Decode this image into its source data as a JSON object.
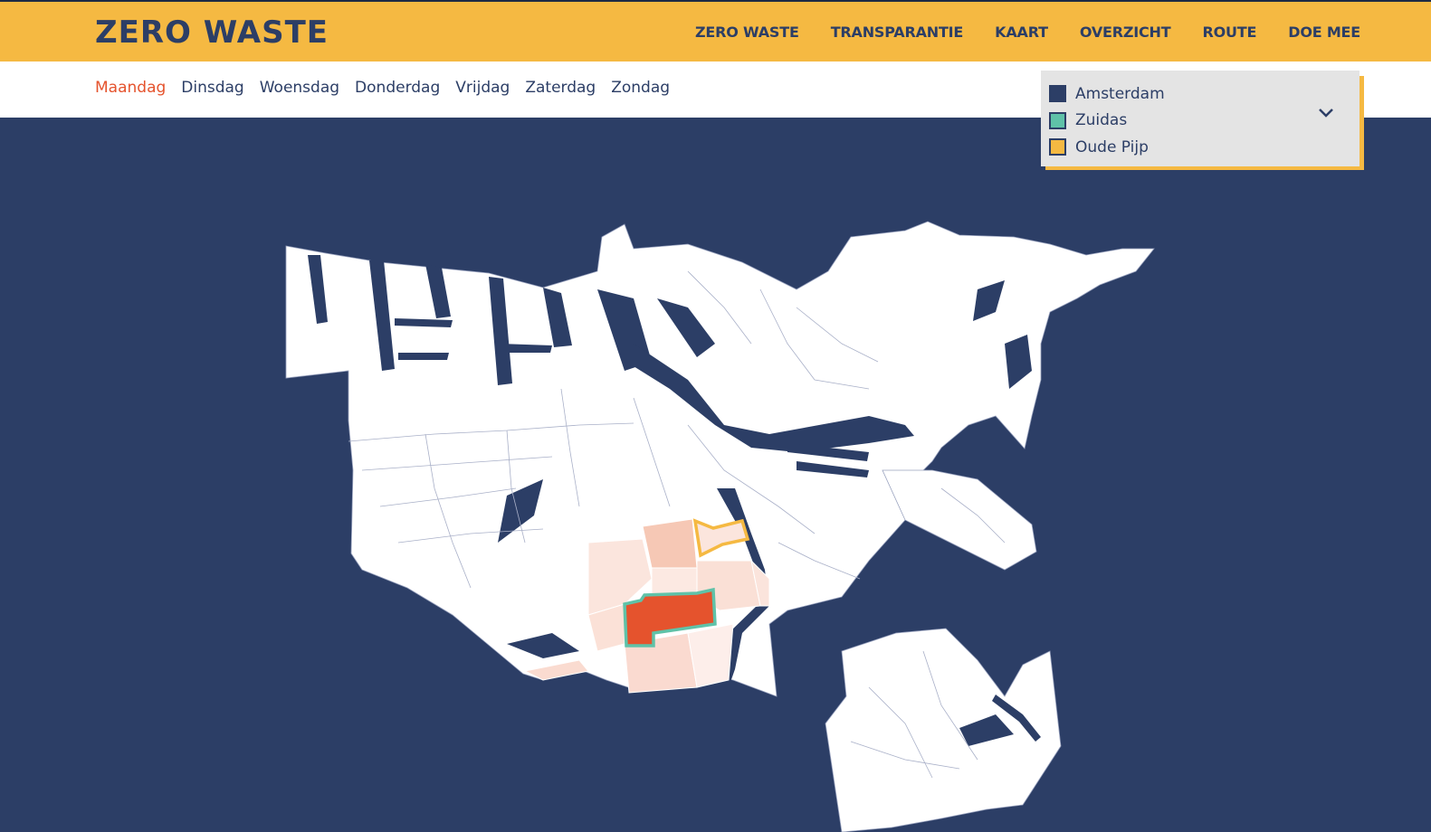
{
  "header": {
    "logo": "ZERO WASTE",
    "nav": [
      "ZERO WASTE",
      "TRANSPARANTIE",
      "KAART",
      "OVERZICHT",
      "ROUTE",
      "DOE MEE"
    ]
  },
  "days": {
    "active": "Maandag",
    "items": [
      "Maandag",
      "Dinsdag",
      "Woensdag",
      "Donderdag",
      "Vrijdag",
      "Zaterdag",
      "Zondag"
    ]
  },
  "legend": {
    "items": [
      {
        "label": "Amsterdam",
        "color": "#2c3e66"
      },
      {
        "label": "Zuidas",
        "color": "#5fc2a8"
      },
      {
        "label": "Oude Pijp",
        "color": "#f5b942"
      }
    ],
    "toggle_icon": "chevron-down-icon"
  },
  "map": {
    "background_color": "#2c3e66",
    "land_color": "#ffffff",
    "highlight_color": "#e5532d",
    "zuidas_outline": "#5fc2a8",
    "oude_pijp_outline": "#f5b942"
  }
}
